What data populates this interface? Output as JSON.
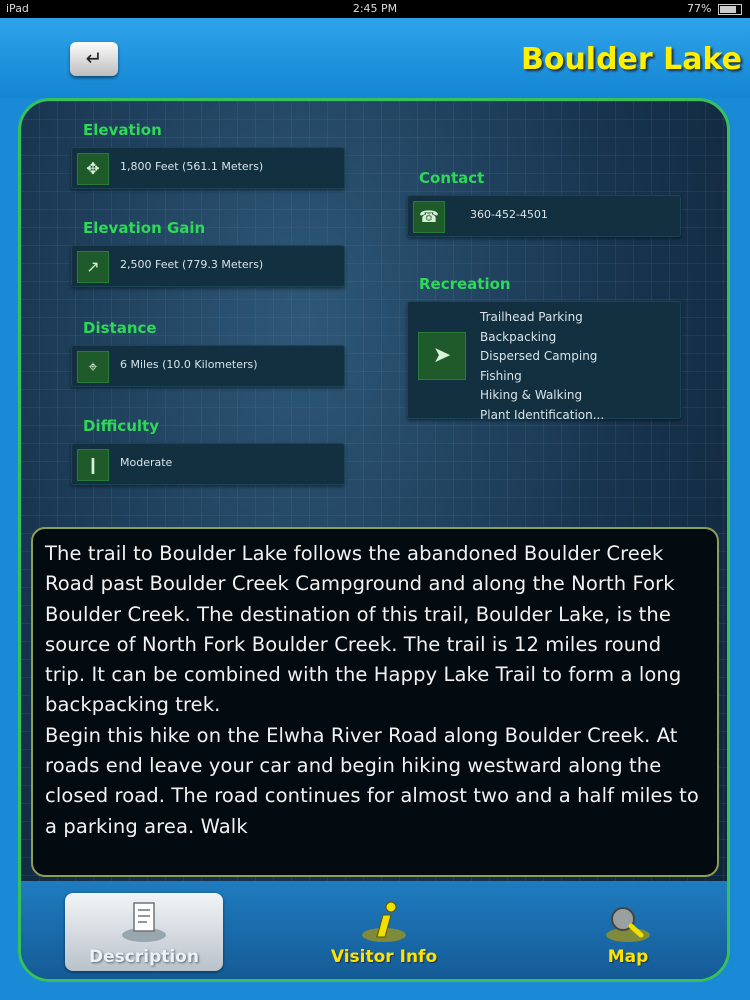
{
  "status_bar": {
    "device": "iPad",
    "time": "2:45 PM",
    "battery": "77%"
  },
  "header": {
    "title": "Boulder Lake"
  },
  "details": {
    "elevation": {
      "label": "Elevation",
      "value": "1,800 Feet (561.1 Meters)"
    },
    "elevation_gain": {
      "label": "Elevation Gain",
      "value": "2,500 Feet (779.3 Meters)"
    },
    "distance": {
      "label": "Distance",
      "value": "6 Miles (10.0 Kilometers)"
    },
    "difficulty": {
      "label": "Difficulty",
      "value": "Moderate"
    },
    "contact": {
      "label": "Contact",
      "value": "360-452-4501"
    },
    "recreation": {
      "label": "Recreation",
      "items": [
        "Trailhead Parking",
        "Backpacking",
        "Dispersed Camping",
        "Fishing",
        "Hiking & Walking",
        "Plant Identification..."
      ]
    }
  },
  "description": "The trail to Boulder Lake follows the abandoned Boulder Creek Road past Boulder Creek Campground and along the North Fork Boulder Creek. The destination of this trail, Boulder Lake, is the source of North Fork Boulder Creek. The trail is 12 miles round trip. It can be combined with the Happy Lake Trail to form a long backpacking trek.\nBegin this hike on the Elwha River Road along Boulder Creek. At roads end leave your car and begin hiking westward along the closed road. The road continues for almost two and a half miles to a parking area. Walk",
  "tabs": [
    {
      "label": "Description",
      "icon": "document-icon",
      "active": true
    },
    {
      "label": "Visitor Info",
      "icon": "info-icon",
      "active": false
    },
    {
      "label": "Map",
      "icon": "map-search-icon",
      "active": false
    }
  ],
  "colors": {
    "accent_green": "#2fd857",
    "title_yellow": "#fff000",
    "tab_yellow": "#ffe300",
    "panel_border": "#36c15c"
  }
}
